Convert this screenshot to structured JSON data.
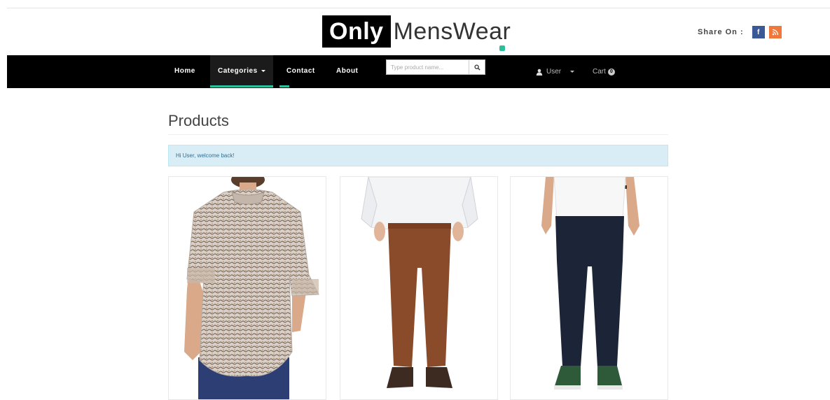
{
  "brand": {
    "part1": "Only",
    "part2": "MensWear"
  },
  "share": {
    "label": "Share On :",
    "facebook_icon": "facebook-icon",
    "rss_icon": "rss-icon"
  },
  "nav": {
    "items": [
      {
        "label": "Home"
      },
      {
        "label": "Categories"
      },
      {
        "label": "Contact"
      },
      {
        "label": "About"
      }
    ],
    "search_placeholder": "Type product name...",
    "user_label": "User",
    "cart_label": "Cart",
    "cart_count": "0"
  },
  "page": {
    "title": "Products",
    "alert": "Hi User, welcome back!"
  },
  "products": [
    {
      "image": "patterned-shirt-back-view"
    },
    {
      "image": "brown-chino-pants-back-view"
    },
    {
      "image": "navy-jeans-back-view"
    }
  ],
  "colors": {
    "accent": "#2bbf9a",
    "navbar": "#000000",
    "alert_bg": "#d9edf7",
    "facebook": "#3b5998",
    "rss": "#f0783c"
  }
}
